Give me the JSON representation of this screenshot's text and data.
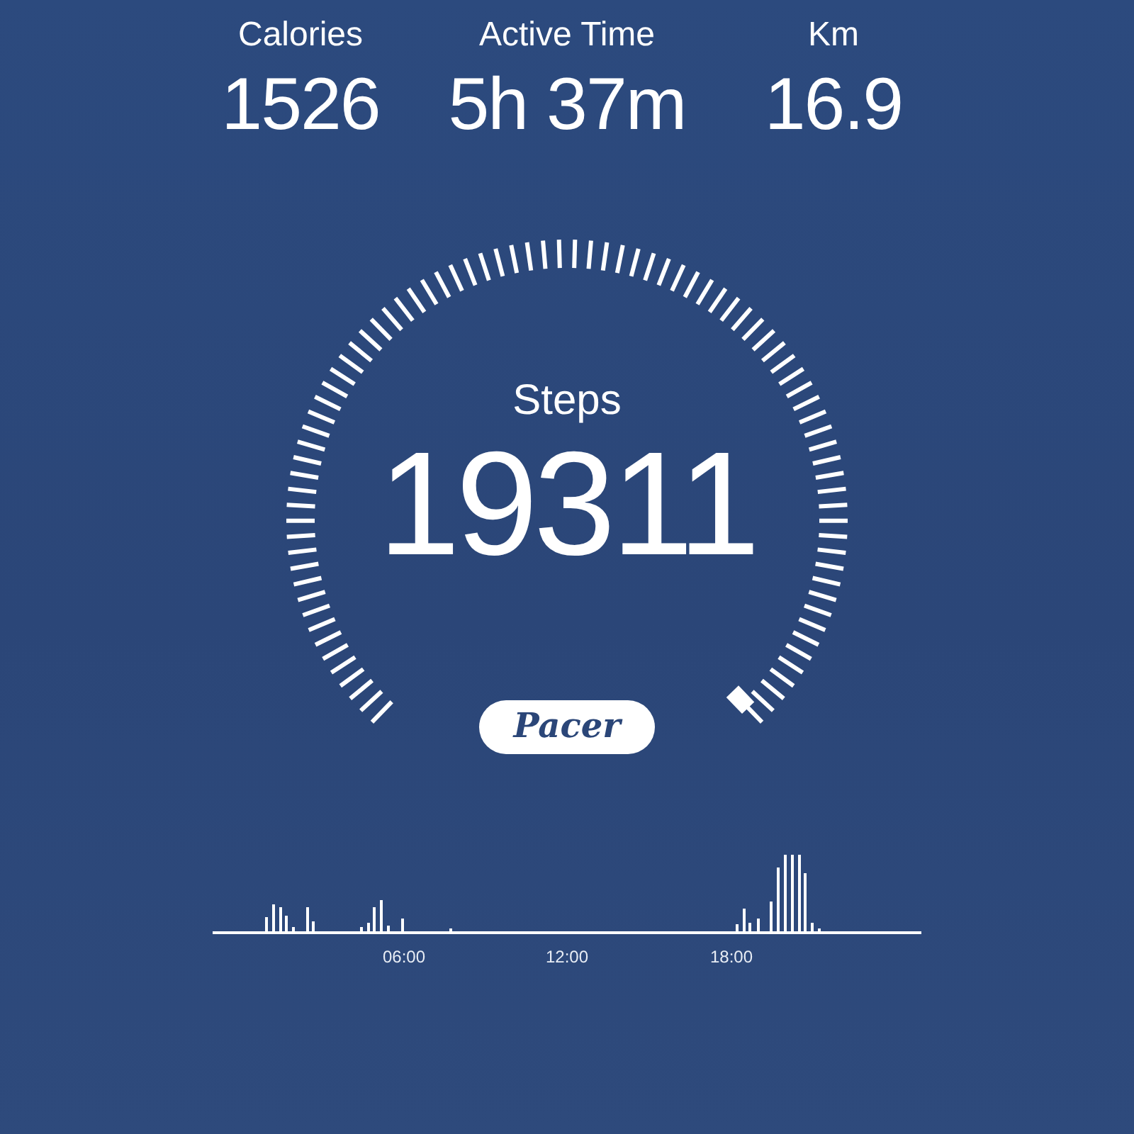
{
  "stats": [
    {
      "label": "Calories",
      "value": "1526"
    },
    {
      "label": "Active Time",
      "value": "5h 37m"
    },
    {
      "label": "Km",
      "value": "16.9"
    }
  ],
  "gauge": {
    "label": "Steps",
    "value": "19311"
  },
  "brand": "Pacer",
  "activity_chart": {
    "time_labels": [
      "06:00",
      "12:00",
      "18:00"
    ]
  }
}
